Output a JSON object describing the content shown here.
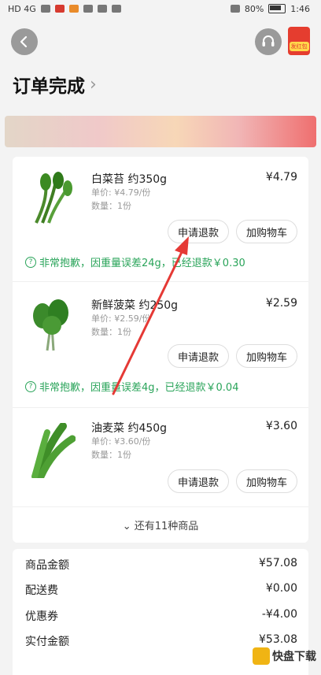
{
  "statusbar": {
    "left_text": "HD 4G",
    "battery": "80%",
    "time": "1:46"
  },
  "header": {
    "title": "订单完成",
    "redpacket_label": "发红包"
  },
  "items": [
    {
      "name": "白菜苔 约350g",
      "price": "¥4.79",
      "unit_price": "单价: ¥4.79/份",
      "quantity": "数量：1份",
      "refund_label": "申请退款",
      "cart_label": "加购物车",
      "notice": "非常抱歉，因重量误差24g，已经退款￥0.30"
    },
    {
      "name": "新鲜菠菜 约250g",
      "price": "¥2.59",
      "unit_price": "单价: ¥2.59/份",
      "quantity": "数量：1份",
      "refund_label": "申请退款",
      "cart_label": "加购物车",
      "notice": "非常抱歉，因重量误差4g，已经退款￥0.04"
    },
    {
      "name": "油麦菜 约450g",
      "price": "¥3.60",
      "unit_price": "单价: ¥3.60/份",
      "quantity": "数量：1份",
      "refund_label": "申请退款",
      "cart_label": "加购物车"
    }
  ],
  "more_items": "还有11种商品",
  "summary": {
    "goods_amount_label": "商品金额",
    "goods_amount": "¥57.08",
    "delivery_label": "配送费",
    "delivery": "¥0.00",
    "coupon_label": "优惠券",
    "coupon": "-¥4.00",
    "paid_label": "实付金额",
    "paid": "¥53.08"
  },
  "watermark": "快盘下载",
  "colors": {
    "accent_green": "#2aa45a",
    "red": "#e53d2f",
    "arrow": "#e53935"
  }
}
